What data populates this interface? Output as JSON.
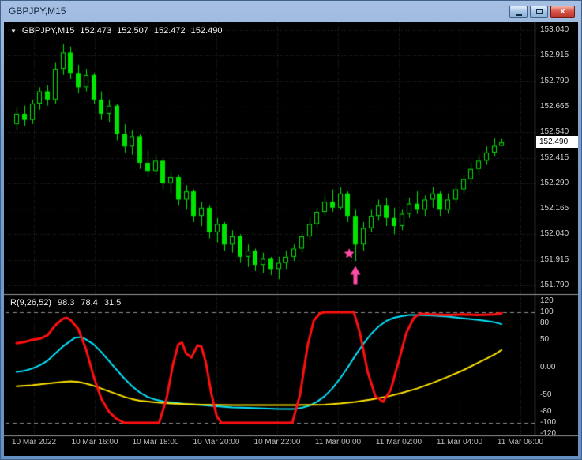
{
  "window": {
    "title": "GBPJPY,M15"
  },
  "icons": {
    "dropdown": "▼",
    "close": "×"
  },
  "ohlc": {
    "symbol": "GBPJPY,M15",
    "open": "152.473",
    "high": "152.507",
    "low": "152.472",
    "close": "152.490"
  },
  "current_price": "152.490",
  "indicator": {
    "name": "R(9,26,52)",
    "values": [
      "98.3",
      "78.4",
      "31.5"
    ]
  },
  "palette": {
    "background": "#000000",
    "grid": "#2e2e2e",
    "separator": "#9a9a9a",
    "candle": "#00e600",
    "level_line": "#8f8f8f",
    "signal": "#ff4da6",
    "axis_text": "#cfcfcf"
  },
  "chart_data": [
    {
      "type": "candlestick",
      "title": "GBPJPY,M15",
      "price_axis": {
        "min": 151.79,
        "max": 153.04,
        "ticks": [
          153.04,
          152.915,
          152.79,
          152.665,
          152.54,
          152.415,
          152.29,
          152.165,
          152.04,
          151.915,
          151.79
        ]
      },
      "time_labels": [
        "10 Mar 2022",
        "10 Mar 16:00",
        "10 Mar 18:00",
        "10 Mar 20:00",
        "10 Mar 22:00",
        "11 Mar 00:00",
        "11 Mar 02:00",
        "11 Mar 04:00",
        "11 Mar 06:00"
      ],
      "candles": [
        [
          152.58,
          152.66,
          152.55,
          152.63
        ],
        [
          152.63,
          152.67,
          152.57,
          152.6
        ],
        [
          152.6,
          152.7,
          152.58,
          152.68
        ],
        [
          152.68,
          152.76,
          152.65,
          152.74
        ],
        [
          152.74,
          152.77,
          152.67,
          152.7
        ],
        [
          152.7,
          152.88,
          152.68,
          152.85
        ],
        [
          152.85,
          152.97,
          152.82,
          152.93
        ],
        [
          152.93,
          152.96,
          152.8,
          152.83
        ],
        [
          152.83,
          152.87,
          152.73,
          152.76
        ],
        [
          152.76,
          152.85,
          152.74,
          152.82
        ],
        [
          152.82,
          152.83,
          152.68,
          152.7
        ],
        [
          152.7,
          152.74,
          152.6,
          152.63
        ],
        [
          152.63,
          152.7,
          152.59,
          152.67
        ],
        [
          152.67,
          152.68,
          152.5,
          152.53
        ],
        [
          152.53,
          152.58,
          152.44,
          152.47
        ],
        [
          152.47,
          152.55,
          152.43,
          152.52
        ],
        [
          152.52,
          152.53,
          152.36,
          152.39
        ],
        [
          152.39,
          152.45,
          152.32,
          152.35
        ],
        [
          152.35,
          152.43,
          152.33,
          152.4
        ],
        [
          152.4,
          152.41,
          152.26,
          152.29
        ],
        [
          152.29,
          152.35,
          152.24,
          152.32
        ],
        [
          152.32,
          152.33,
          152.18,
          152.21
        ],
        [
          152.21,
          152.28,
          152.16,
          152.25
        ],
        [
          152.25,
          152.26,
          152.1,
          152.13
        ],
        [
          152.13,
          152.2,
          152.08,
          152.17
        ],
        [
          152.17,
          152.18,
          152.02,
          152.05
        ],
        [
          152.05,
          152.12,
          152.0,
          152.09
        ],
        [
          152.09,
          152.1,
          151.96,
          151.99
        ],
        [
          151.99,
          152.06,
          151.95,
          152.03
        ],
        [
          152.03,
          152.04,
          151.9,
          151.93
        ],
        [
          151.93,
          151.99,
          151.88,
          151.96
        ],
        [
          151.96,
          151.97,
          151.86,
          151.89
        ],
        [
          151.89,
          151.95,
          151.85,
          151.92
        ],
        [
          151.92,
          151.93,
          151.84,
          151.87
        ],
        [
          151.87,
          151.93,
          151.82,
          151.9
        ],
        [
          151.9,
          151.96,
          151.87,
          151.93
        ],
        [
          151.93,
          151.99,
          151.91,
          151.97
        ],
        [
          151.97,
          152.05,
          151.95,
          152.03
        ],
        [
          152.03,
          152.12,
          152.01,
          152.09
        ],
        [
          152.09,
          152.17,
          152.07,
          152.15
        ],
        [
          152.15,
          152.23,
          152.13,
          152.2
        ],
        [
          152.2,
          152.26,
          152.15,
          152.17
        ],
        [
          152.17,
          152.27,
          152.16,
          152.24
        ],
        [
          152.24,
          152.25,
          152.1,
          152.13
        ],
        [
          152.13,
          152.16,
          151.91,
          151.99
        ],
        [
          151.99,
          152.1,
          151.96,
          152.07
        ],
        [
          152.07,
          152.16,
          152.05,
          152.13
        ],
        [
          152.13,
          152.21,
          152.11,
          152.18
        ],
        [
          152.18,
          152.22,
          152.08,
          152.12
        ],
        [
          152.12,
          152.17,
          152.04,
          152.08
        ],
        [
          152.08,
          152.16,
          152.06,
          152.14
        ],
        [
          152.14,
          152.22,
          152.12,
          152.19
        ],
        [
          152.19,
          152.25,
          152.14,
          152.16
        ],
        [
          152.16,
          152.23,
          152.13,
          152.21
        ],
        [
          152.21,
          152.27,
          152.17,
          152.24
        ],
        [
          152.24,
          152.25,
          152.13,
          152.16
        ],
        [
          152.16,
          152.24,
          152.14,
          152.21
        ],
        [
          152.21,
          152.28,
          152.19,
          152.26
        ],
        [
          152.26,
          152.33,
          152.24,
          152.31
        ],
        [
          152.31,
          152.39,
          152.29,
          152.36
        ],
        [
          152.36,
          152.43,
          152.33,
          152.4
        ],
        [
          152.4,
          152.47,
          152.38,
          152.44
        ],
        [
          152.44,
          152.51,
          152.42,
          152.473
        ],
        [
          152.473,
          152.507,
          152.472,
          152.49
        ]
      ],
      "signal": {
        "type": "buy",
        "color": "#ff4da6",
        "star": {
          "bar": 43.2,
          "price": 151.945
        },
        "arrow": {
          "bar": 44,
          "price": 151.885
        }
      }
    },
    {
      "type": "line",
      "title": "R(9,26,52) 98.3 78.4 31.5",
      "ylim": [
        -120,
        120
      ],
      "levels": [
        100,
        -100
      ],
      "ticks": [
        {
          "label": "120",
          "value": 120
        },
        {
          "label": "100",
          "value": 100
        },
        {
          "label": "80",
          "value": 80
        },
        {
          "label": "50",
          "value": 50
        },
        {
          "label": "0.00",
          "value": 0
        },
        {
          "label": "-50",
          "value": -50
        },
        {
          "label": "-80",
          "value": -80
        },
        {
          "label": "-100",
          "value": -100
        },
        {
          "label": "-120",
          "value": -120
        }
      ],
      "series": [
        {
          "name": "cyan-line",
          "color": "#00e5ff",
          "width": 2,
          "points": [
            [
              0,
              -8
            ],
            [
              1,
              -6
            ],
            [
              2,
              -2
            ],
            [
              3,
              4
            ],
            [
              4,
              12
            ],
            [
              5,
              25
            ],
            [
              6,
              38
            ],
            [
              7,
              48
            ],
            [
              7.6,
              54
            ],
            [
              8.4,
              55
            ],
            [
              9,
              51
            ],
            [
              10,
              42
            ],
            [
              11,
              28
            ],
            [
              12,
              12
            ],
            [
              13,
              -4
            ],
            [
              14,
              -20
            ],
            [
              15,
              -34
            ],
            [
              16,
              -45
            ],
            [
              17,
              -53
            ],
            [
              18,
              -58
            ],
            [
              19,
              -61
            ],
            [
              20,
              -63
            ],
            [
              22,
              -66
            ],
            [
              24,
              -68
            ],
            [
              26,
              -70
            ],
            [
              28,
              -72
            ],
            [
              30,
              -73
            ],
            [
              32,
              -74
            ],
            [
              34,
              -75
            ],
            [
              36,
              -75
            ],
            [
              37,
              -73
            ],
            [
              38,
              -69
            ],
            [
              39,
              -62
            ],
            [
              40,
              -52
            ],
            [
              41,
              -38
            ],
            [
              42,
              -20
            ],
            [
              43,
              0
            ],
            [
              44,
              22
            ],
            [
              45,
              42
            ],
            [
              46,
              60
            ],
            [
              47,
              74
            ],
            [
              48,
              84
            ],
            [
              49,
              90
            ],
            [
              50,
              93
            ],
            [
              51,
              95
            ],
            [
              52,
              95
            ],
            [
              54,
              94
            ],
            [
              56,
              92
            ],
            [
              58,
              89
            ],
            [
              60,
              86
            ],
            [
              62,
              82
            ],
            [
              63,
              78.4
            ]
          ]
        },
        {
          "name": "yellow-line",
          "color": "#ffe400",
          "width": 2,
          "points": [
            [
              0,
              -34
            ],
            [
              2,
              -32
            ],
            [
              4,
              -29
            ],
            [
              6,
              -26
            ],
            [
              7,
              -25
            ],
            [
              8,
              -26
            ],
            [
              9,
              -29
            ],
            [
              10,
              -33
            ],
            [
              11,
              -38
            ],
            [
              12,
              -43
            ],
            [
              13,
              -48
            ],
            [
              14,
              -53
            ],
            [
              15,
              -57
            ],
            [
              16,
              -60
            ],
            [
              18,
              -63
            ],
            [
              20,
              -65
            ],
            [
              22,
              -66
            ],
            [
              24,
              -67
            ],
            [
              28,
              -68
            ],
            [
              32,
              -68
            ],
            [
              36,
              -68
            ],
            [
              38,
              -67.5
            ],
            [
              40,
              -67
            ],
            [
              42,
              -65
            ],
            [
              44,
              -62
            ],
            [
              46,
              -58
            ],
            [
              48,
              -53
            ],
            [
              50,
              -46
            ],
            [
              52,
              -38
            ],
            [
              54,
              -28
            ],
            [
              56,
              -17
            ],
            [
              58,
              -5
            ],
            [
              60,
              9
            ],
            [
              61,
              16
            ],
            [
              62,
              23
            ],
            [
              63,
              31.5
            ]
          ]
        },
        {
          "name": "red-line",
          "color": "#ff1010",
          "width": 3,
          "points": [
            [
              0,
              44
            ],
            [
              1,
              46
            ],
            [
              2,
              50
            ],
            [
              3,
              52
            ],
            [
              4,
              58
            ],
            [
              5,
              76
            ],
            [
              6,
              88
            ],
            [
              6.5,
              90
            ],
            [
              7,
              86
            ],
            [
              8,
              70
            ],
            [
              9,
              34
            ],
            [
              10,
              -16
            ],
            [
              11,
              -56
            ],
            [
              12,
              -80
            ],
            [
              13,
              -93
            ],
            [
              14,
              -100
            ],
            [
              18.5,
              -100
            ],
            [
              19.5,
              -55
            ],
            [
              20.3,
              5
            ],
            [
              21,
              42
            ],
            [
              21.5,
              45
            ],
            [
              22,
              26
            ],
            [
              22.7,
              18
            ],
            [
              23.5,
              40
            ],
            [
              24,
              38
            ],
            [
              24.6,
              8
            ],
            [
              25.3,
              -48
            ],
            [
              26,
              -88
            ],
            [
              26.6,
              -100
            ],
            [
              35.8,
              -100
            ],
            [
              36.8,
              -50
            ],
            [
              37.8,
              40
            ],
            [
              38.6,
              85
            ],
            [
              39.4,
              98
            ],
            [
              40,
              100
            ],
            [
              43.8,
              100
            ],
            [
              44.6,
              62
            ],
            [
              45.6,
              -8
            ],
            [
              46.6,
              -52
            ],
            [
              47.6,
              -62
            ],
            [
              48.6,
              -40
            ],
            [
              49.6,
              10
            ],
            [
              50.6,
              62
            ],
            [
              51.6,
              90
            ],
            [
              52.4,
              97
            ],
            [
              54,
              96
            ],
            [
              56,
              95
            ],
            [
              58,
              96
            ],
            [
              60,
              95
            ],
            [
              62,
              96
            ],
            [
              63,
              98.3
            ]
          ]
        }
      ]
    }
  ]
}
